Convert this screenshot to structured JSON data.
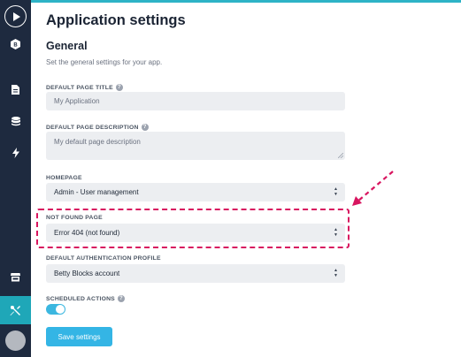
{
  "colors": {
    "sidebar_bg": "#1e2a3f",
    "accent_teal": "#1fa7b8",
    "primary_button": "#34b5e5",
    "highlight": "#d8155f",
    "field_bg": "#eceef1"
  },
  "sidebar": {
    "icons": [
      "play-icon",
      "blocks-icon",
      "page-icon",
      "database-icon",
      "bolt-icon",
      "store-icon",
      "tools-icon"
    ],
    "active_item": "tools-icon"
  },
  "page": {
    "title": "Application settings",
    "section_title": "General",
    "section_description": "Set the general settings for your app."
  },
  "fields": {
    "default_page_title": {
      "label": "DEFAULT PAGE TITLE",
      "placeholder": "My Application"
    },
    "default_page_description": {
      "label": "DEFAULT PAGE DESCRIPTION",
      "placeholder": "My default page description"
    },
    "homepage": {
      "label": "HOMEPAGE",
      "value": "Admin - User management"
    },
    "not_found_page": {
      "label": "NOT FOUND PAGE",
      "value": "Error 404 (not found)"
    },
    "default_authentication_profile": {
      "label": "DEFAULT AUTHENTICATION PROFILE",
      "value": "Betty Blocks account"
    },
    "scheduled_actions": {
      "label": "SCHEDULED ACTIONS",
      "enabled": true
    }
  },
  "help_glyph": "?",
  "select_arrows": {
    "up": "▲",
    "down": "▼"
  },
  "save_button": "Save settings"
}
